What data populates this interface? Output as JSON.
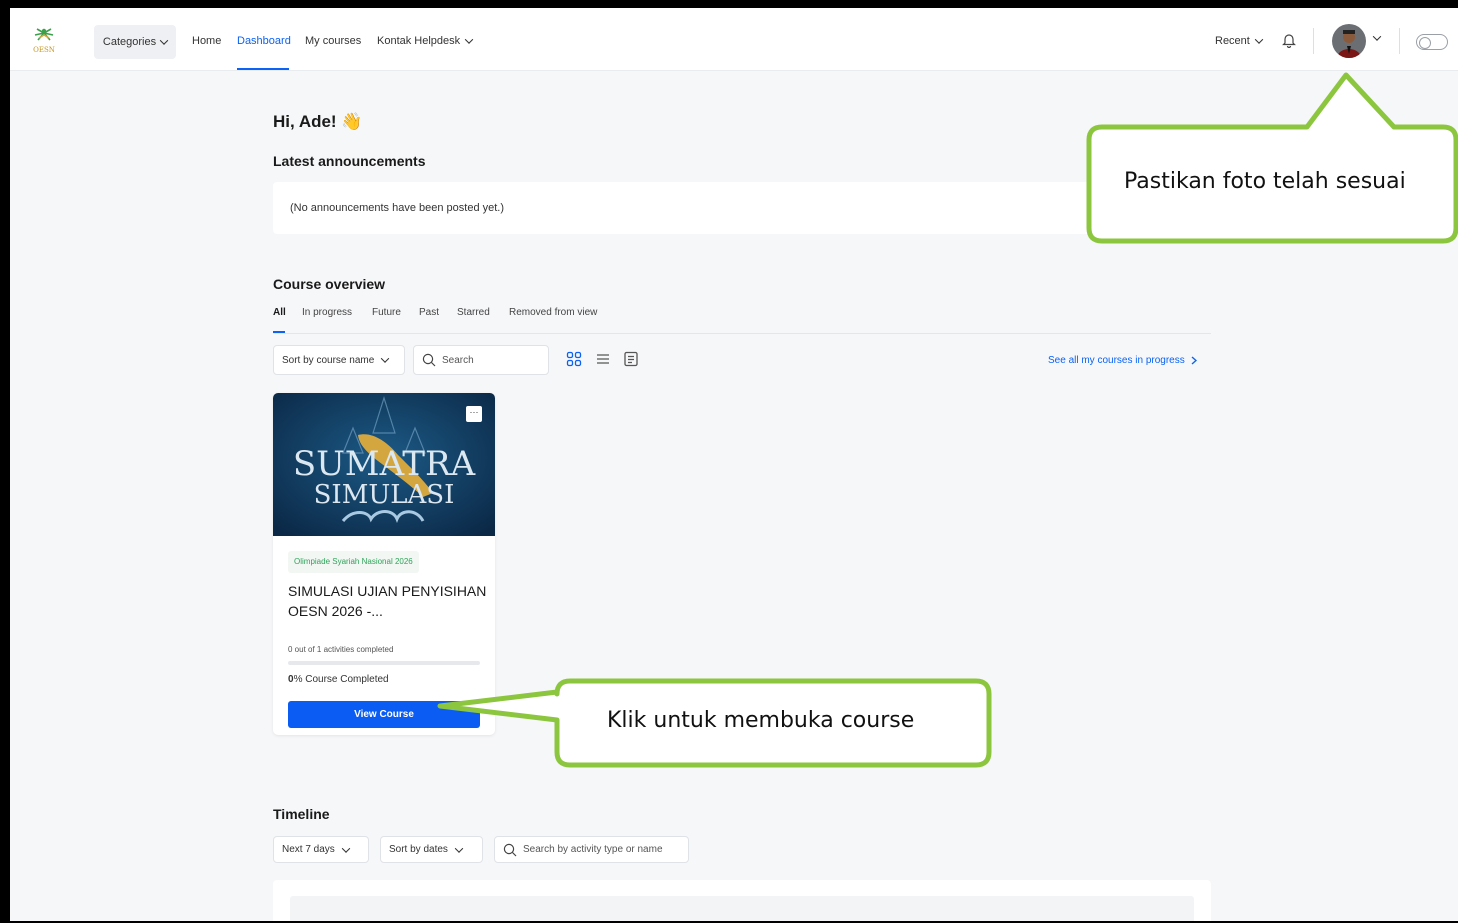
{
  "navbar": {
    "categories_label": "Categories",
    "links": [
      "Home",
      "Dashboard",
      "My courses",
      "Kontak Helpdesk"
    ],
    "active_link": "Dashboard",
    "recent_label": "Recent",
    "logo_text": "OESN"
  },
  "greeting": "Hi, Ade! 👋",
  "announcements": {
    "heading": "Latest announcements",
    "empty_text": "(No announcements have been posted yet.)"
  },
  "course_overview": {
    "heading": "Course overview",
    "tabs": [
      "All",
      "In progress",
      "Future",
      "Past",
      "Starred",
      "Removed from view"
    ],
    "active_tab": "All",
    "sort_label": "Sort by course name",
    "search_placeholder": "Search",
    "see_all_label": "See all my courses in progress"
  },
  "course_card": {
    "image_text_line1": "SUMATRA",
    "image_text_line2": "SIMULASI",
    "category": "Olimpiade Syariah Nasional 2026",
    "title": "SIMULASI UJIAN PENYISIHAN OESN 2026 -...",
    "activities": "0 out of 1 activities completed",
    "progress_percent": 0,
    "completed_value": "0",
    "completed_suffix": "% Course Completed",
    "view_button": "View Course",
    "menu_glyph": "···"
  },
  "timeline": {
    "heading": "Timeline",
    "range_label": "Next 7 days",
    "sort_label": "Sort by dates",
    "search_placeholder": "Search by activity type or name"
  },
  "callouts": {
    "photo": "Pastikan foto telah sesuai",
    "course": "Klik untuk membuka course"
  },
  "colors": {
    "accent": "#0b62f4",
    "callout_border": "#8cc63f",
    "page_bg": "#f6f7f9"
  }
}
